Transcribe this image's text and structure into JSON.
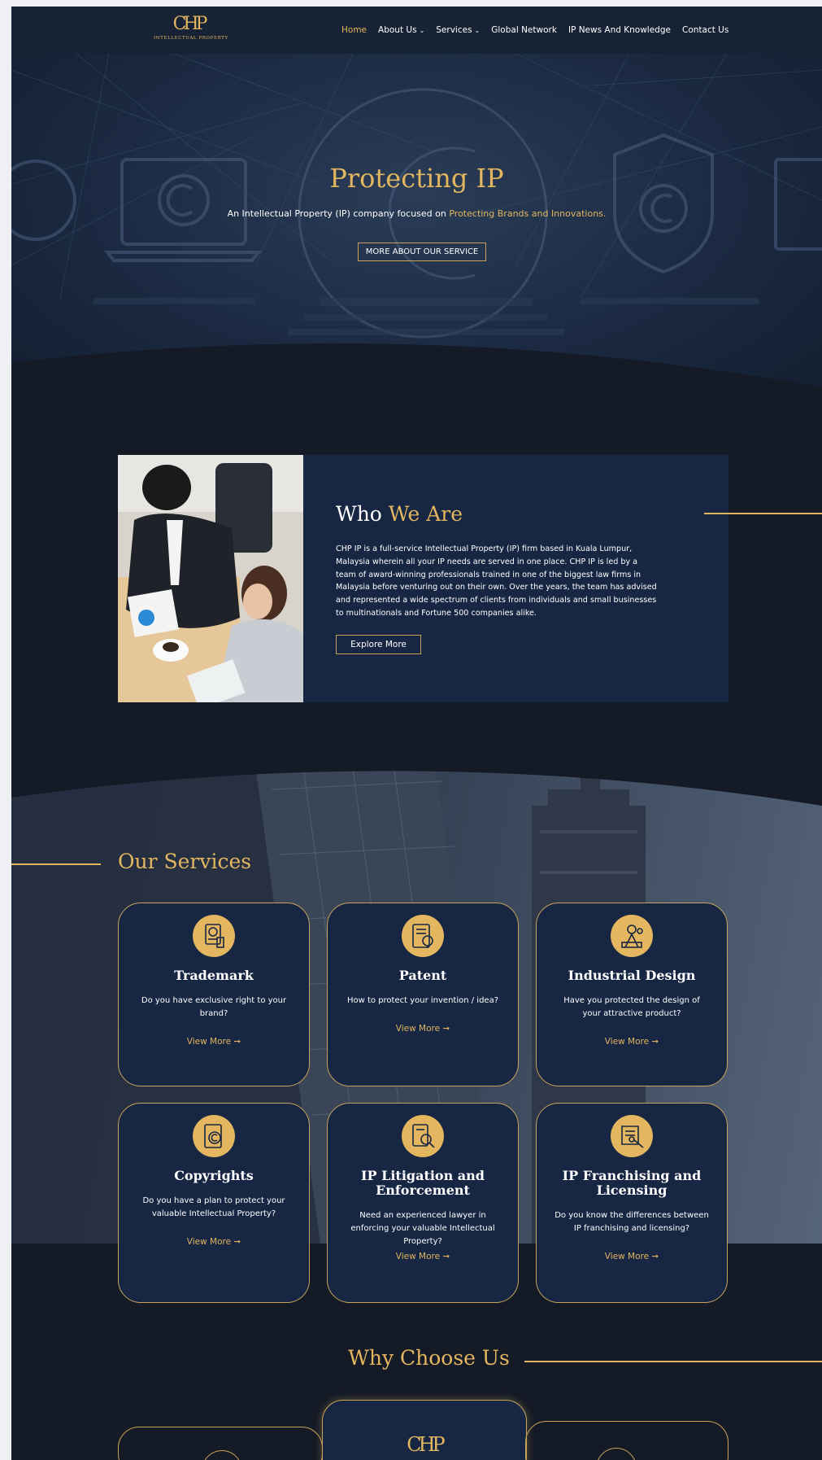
{
  "header": {
    "logo_mark": "CHP",
    "logo_sub": "INTELLECTUAL PROPERTY",
    "nav": [
      {
        "label": "Home",
        "active": true,
        "dropdown": false
      },
      {
        "label": "About Us",
        "active": false,
        "dropdown": true
      },
      {
        "label": "Services",
        "active": false,
        "dropdown": true
      },
      {
        "label": "Global Network",
        "active": false,
        "dropdown": false
      },
      {
        "label": "IP News And Knowledge",
        "active": false,
        "dropdown": false
      },
      {
        "label": "Contact Us",
        "active": false,
        "dropdown": false
      }
    ]
  },
  "hero": {
    "title": "Protecting IP",
    "subtitle_prefix": "An Intellectual Property (IP) company focused on ",
    "subtitle_highlight": "Protecting Brands and Innovations.",
    "button": "MORE ABOUT OUR SERVICE"
  },
  "who": {
    "title_white": "Who ",
    "title_gold": "We Are",
    "text": "CHP IP is a full-service Intellectual Property (IP) firm based in Kuala Lumpur, Malaysia wherein all your IP needs are served in one place. CHP IP is led by a team of award-winning professionals trained in one of the biggest law firms in Malaysia before venturing out on their own. Over the years, the team has advised and represented a wide spectrum of clients from individuals and small businesses to multinationals and Fortune 500 companies alike.",
    "button": "Explore More"
  },
  "services": {
    "title": "Our Services",
    "cards": [
      {
        "title": "Trademark",
        "desc": "Do you have exclusive right to your brand?",
        "link": "View More ➞",
        "icon": "trademark-icon"
      },
      {
        "title": "Patent",
        "desc": "How to protect your invention / idea?",
        "link": "View More ➞",
        "icon": "patent-icon"
      },
      {
        "title": "Industrial Design",
        "desc": "Have you protected the design of your attractive product?",
        "link": "View More ➞",
        "icon": "industrial-design-icon"
      },
      {
        "title": "Copyrights",
        "desc": "Do you have a plan to protect your valuable Intellectual Property?",
        "link": "View More ➞",
        "icon": "copyright-icon"
      },
      {
        "title": "IP Litigation and Enforcement",
        "desc": "Need an experienced lawyer in enforcing your valuable Intellectual Property?",
        "link": "View More ➞",
        "icon": "litigation-icon"
      },
      {
        "title": "IP Franchising and Licensing",
        "desc": "Do you know the differences between IP franchising and licensing?",
        "link": "View More ➞",
        "icon": "licensing-icon"
      }
    ]
  },
  "why": {
    "title": "Why Choose Us",
    "logo_mark": "CHP"
  },
  "colors": {
    "gold": "#e3b65f",
    "navy": "#172643",
    "page_bg": "#141a26"
  }
}
